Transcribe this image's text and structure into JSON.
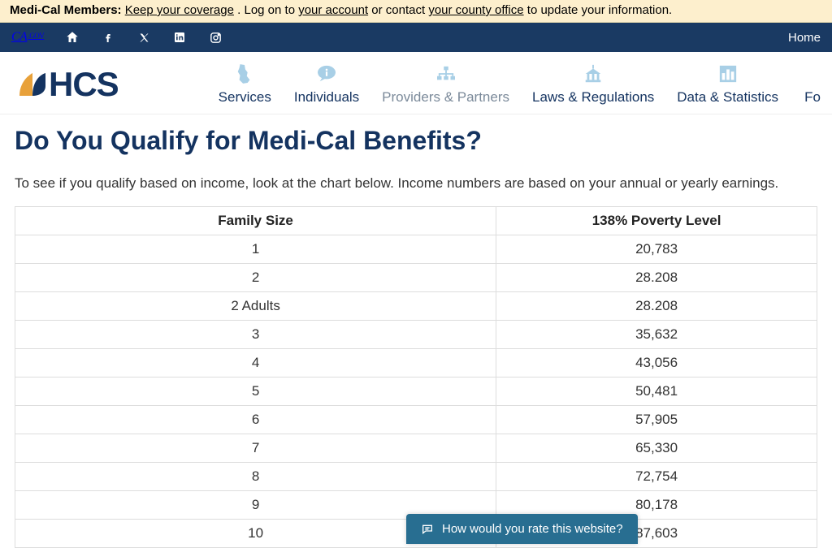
{
  "alert": {
    "prefix": "Medi-Cal Members:",
    "link1": "Keep your coverage",
    "mid1": ". Log on to ",
    "link2": "your account",
    "mid2": " or contact ",
    "link3": "your county office",
    "suffix": " to update your information."
  },
  "util": {
    "cagov_main": "CA",
    "cagov_sub": ".GOV",
    "home": "Home"
  },
  "logo": {
    "text": "HCS"
  },
  "nav": {
    "services": "Services",
    "individuals": "Individuals",
    "providers": "Providers & Partners",
    "laws": "Laws & Regulations",
    "data": "Data & Statistics",
    "forms": "Fo"
  },
  "page": {
    "title": "Do You Qualify for Medi-Cal Benefits?",
    "intro": "To see if you qualify based on income, look at the chart below. Income numbers are based on your annual or yearly earnings."
  },
  "table": {
    "col1": "Family Size",
    "col2": "138% Poverty Level",
    "rows": [
      {
        "size": "1",
        "level": "20,783"
      },
      {
        "size": "2",
        "level": "28.208"
      },
      {
        "size": "2 Adults",
        "level": "28.208"
      },
      {
        "size": "3",
        "level": "35,632"
      },
      {
        "size": "4",
        "level": "43,056"
      },
      {
        "size": "5",
        "level": "50,481"
      },
      {
        "size": "6",
        "level": "57,905"
      },
      {
        "size": "7",
        "level": "65,330"
      },
      {
        "size": "8",
        "level": "72,754"
      },
      {
        "size": "9",
        "level": "80,178"
      },
      {
        "size": "10",
        "level": "87,603"
      }
    ]
  },
  "feedback": {
    "text": "How would you rate this website?"
  }
}
